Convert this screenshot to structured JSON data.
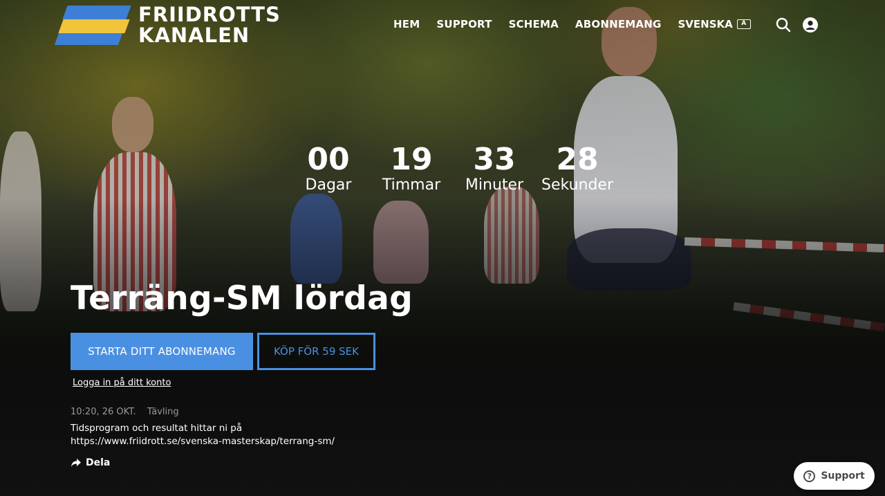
{
  "brand": {
    "logo_line1": "FRIIDROTTS",
    "logo_line2": "KANALEN",
    "colors": {
      "blue": "#3d7fd6",
      "yellow": "#f2c43c"
    }
  },
  "nav": {
    "items": [
      {
        "label": "HEM"
      },
      {
        "label": "SUPPORT"
      },
      {
        "label": "SCHEMA"
      },
      {
        "label": "ABONNEMANG"
      }
    ],
    "language": "SVENSKA",
    "language_icon": "translate-icon",
    "search_icon": "search-icon",
    "account_icon": "user-account-icon"
  },
  "countdown": [
    {
      "value": "00",
      "label": "Dagar"
    },
    {
      "value": "19",
      "label": "Timmar"
    },
    {
      "value": "33",
      "label": "Minuter"
    },
    {
      "value": "28",
      "label": "Sekunder"
    }
  ],
  "event": {
    "title": "Terräng-SM lördag",
    "time": "10:20, 26 OKT.",
    "category": "Tävling",
    "description": "Tidsprogram och resultat hittar ni på https://www.friidrott.se/svenska-masterskap/terrang-sm/"
  },
  "actions": {
    "subscribe_label": "STARTA DITT ABONNEMANG",
    "buy_label": "KÖP FÖR 59 SEK",
    "login_label": "Logga in på ditt konto",
    "share_label": "Dela",
    "accent_color": "#4a90e2"
  },
  "support_widget": {
    "label": "Support"
  }
}
